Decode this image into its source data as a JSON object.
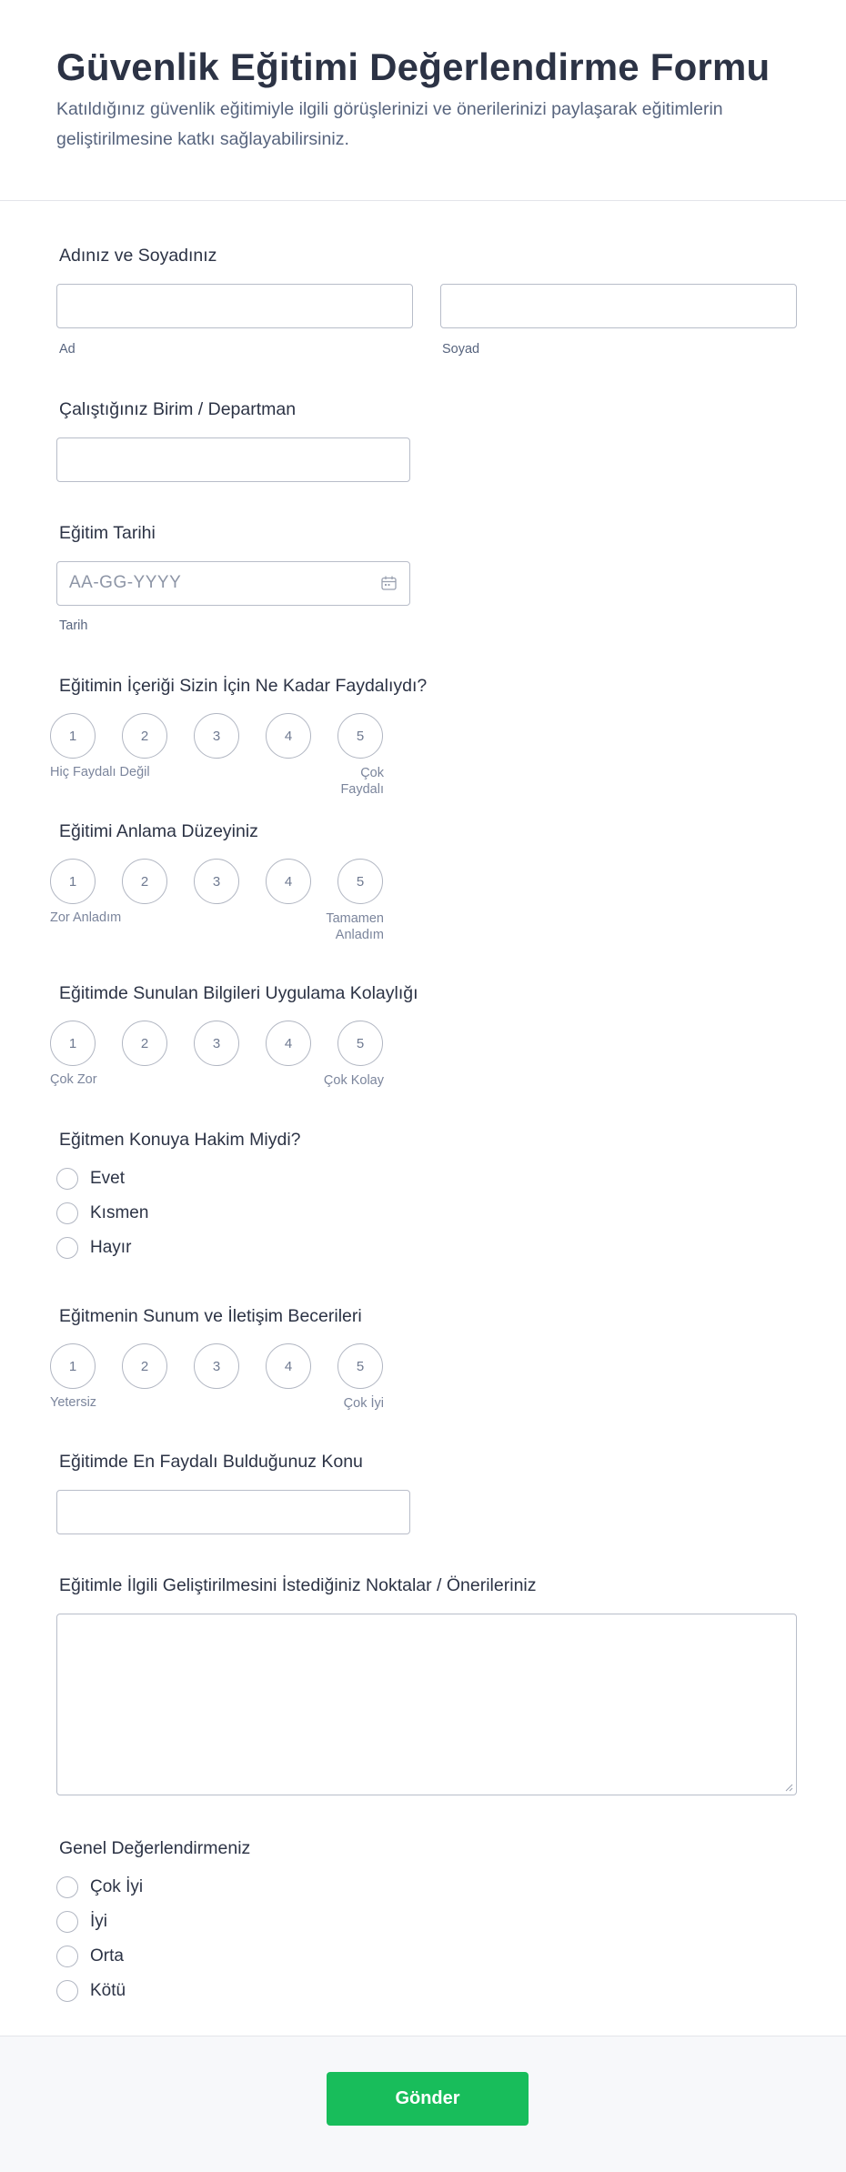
{
  "form": {
    "title": "Güvenlik Eğitimi Değerlendirme Formu",
    "subtitle": "Katıldığınız güvenlik eğitimiyle ilgili görüşlerinizi ve önerilerinizi paylaşarak eğitimlerin geliştirilmesine katkı sağlayabilirsiniz."
  },
  "name_field": {
    "label": "Adınız ve Soyadınız",
    "first_sublabel": "Ad",
    "last_sublabel": "Soyad",
    "first_value": "",
    "last_value": ""
  },
  "department_field": {
    "label": "Çalıştığınız Birim / Departman",
    "value": ""
  },
  "date_field": {
    "label": "Eğitim Tarihi",
    "placeholder": "AA-GG-YYYY",
    "sublabel": "Tarih",
    "icon": "calendar-icon"
  },
  "content_usefulness": {
    "label": "Eğitimin İçeriği Sizin İçin Ne Kadar Faydalıydı?",
    "options": [
      "1",
      "2",
      "3",
      "4",
      "5"
    ],
    "min_label": "Hiç Faydalı Değil",
    "max_label": "Çok Faydalı"
  },
  "understanding_level": {
    "label": "Eğitimi Anlama Düzeyiniz",
    "options": [
      "1",
      "2",
      "3",
      "4",
      "5"
    ],
    "min_label": "Zor Anladım",
    "max_label": "Tamamen Anladım"
  },
  "applicability": {
    "label": "Eğitimde Sunulan Bilgileri Uygulama Kolaylığı",
    "options": [
      "1",
      "2",
      "3",
      "4",
      "5"
    ],
    "min_label": "Çok Zor",
    "max_label": "Çok Kolay"
  },
  "trainer_mastery": {
    "label": "Eğitmen Konuya Hakim Miydi?",
    "options": [
      "Evet",
      "Kısmen",
      "Hayır"
    ]
  },
  "trainer_skills": {
    "label": "Eğitmenin Sunum ve İletişim Becerileri",
    "options": [
      "1",
      "2",
      "3",
      "4",
      "5"
    ],
    "min_label": "Yetersiz",
    "max_label": "Çok İyi"
  },
  "most_useful_topic": {
    "label": "Eğitimde En Faydalı Bulduğunuz Konu",
    "value": ""
  },
  "suggestions": {
    "label": "Eğitimle İlgili Geliştirilmesini İstediğiniz Noktalar / Önerileriniz",
    "value": ""
  },
  "overall_rating": {
    "label": "Genel Değerlendirmeniz",
    "options": [
      "Çok İyi",
      "İyi",
      "Orta",
      "Kötü"
    ]
  },
  "submit": {
    "label": "Gönder",
    "color": "#18bd5b"
  }
}
